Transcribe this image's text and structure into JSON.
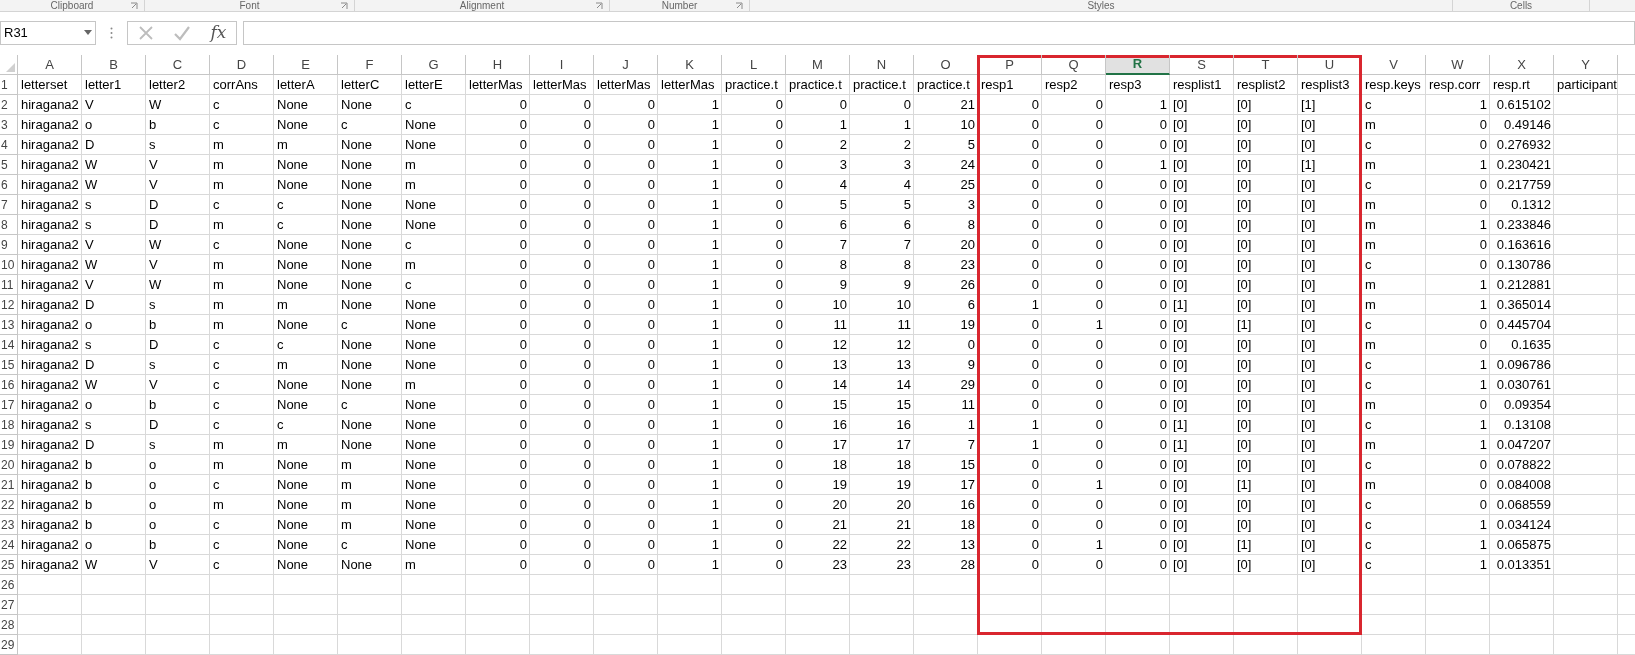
{
  "ribbon_groups": [
    {
      "label": "Clipboard",
      "launcher": true
    },
    {
      "label": "Font",
      "launcher": true
    },
    {
      "label": "Alignment",
      "launcher": true
    },
    {
      "label": "Number",
      "launcher": true
    },
    {
      "label": "Styles",
      "launcher": false
    },
    {
      "label": "Cells",
      "launcher": false
    }
  ],
  "formula_bar": {
    "name_box": "R31",
    "cancel_disabled": true,
    "enter_disabled": true,
    "function_label": "fx"
  },
  "columns": [
    {
      "letter": "A",
      "selected": false,
      "kind": "text",
      "boxed": false
    },
    {
      "letter": "B",
      "selected": false,
      "kind": "text",
      "boxed": false
    },
    {
      "letter": "C",
      "selected": false,
      "kind": "text",
      "boxed": false
    },
    {
      "letter": "D",
      "selected": false,
      "kind": "text",
      "boxed": false
    },
    {
      "letter": "E",
      "selected": false,
      "kind": "text",
      "boxed": false
    },
    {
      "letter": "F",
      "selected": false,
      "kind": "text",
      "boxed": false
    },
    {
      "letter": "G",
      "selected": false,
      "kind": "text",
      "boxed": false
    },
    {
      "letter": "H",
      "selected": false,
      "kind": "number",
      "boxed": false
    },
    {
      "letter": "I",
      "selected": false,
      "kind": "number",
      "boxed": false
    },
    {
      "letter": "J",
      "selected": false,
      "kind": "number",
      "boxed": false
    },
    {
      "letter": "K",
      "selected": false,
      "kind": "number",
      "boxed": false
    },
    {
      "letter": "L",
      "selected": false,
      "kind": "number",
      "boxed": false
    },
    {
      "letter": "M",
      "selected": false,
      "kind": "number",
      "boxed": false
    },
    {
      "letter": "N",
      "selected": false,
      "kind": "number",
      "boxed": false
    },
    {
      "letter": "O",
      "selected": false,
      "kind": "number",
      "boxed": false
    },
    {
      "letter": "P",
      "selected": false,
      "kind": "number",
      "boxed": true
    },
    {
      "letter": "Q",
      "selected": false,
      "kind": "number",
      "boxed": true
    },
    {
      "letter": "R",
      "selected": true,
      "kind": "number",
      "boxed": true
    },
    {
      "letter": "S",
      "selected": false,
      "kind": "text",
      "boxed": true
    },
    {
      "letter": "T",
      "selected": false,
      "kind": "text",
      "boxed": true
    },
    {
      "letter": "U",
      "selected": false,
      "kind": "text",
      "boxed": true
    },
    {
      "letter": "V",
      "selected": false,
      "kind": "text",
      "boxed": false
    },
    {
      "letter": "W",
      "selected": false,
      "kind": "number",
      "boxed": false
    },
    {
      "letter": "X",
      "selected": false,
      "kind": "number",
      "boxed": false
    },
    {
      "letter": "Y",
      "selected": false,
      "kind": "text",
      "boxed": false
    }
  ],
  "rows": [
    {
      "number": "1",
      "kind": "header",
      "cells": [
        "letterset",
        "letter1",
        "letter2",
        "corrAns",
        "letterA",
        "letterC",
        "letterE",
        "letterMas",
        "letterMas",
        "letterMas",
        "letterMas",
        "practice.t",
        "practice.t",
        "practice.t",
        "practice.t",
        "resp1",
        "resp2",
        "resp3",
        "resplist1",
        "resplist2",
        "resplist3",
        "resp.keys",
        "resp.corr",
        "resp.rt",
        "participant"
      ]
    },
    {
      "number": "2",
      "kind": "data",
      "cells": [
        "hiragana2",
        "V",
        "W",
        "c",
        "None",
        "None",
        "c",
        "0",
        "0",
        "0",
        "1",
        "0",
        "0",
        "0",
        "21",
        "0",
        "0",
        "1",
        "[0]",
        "[0]",
        "[1]",
        "c",
        "1",
        "0.615102"
      ]
    },
    {
      "number": "3",
      "kind": "data",
      "cells": [
        "hiragana2",
        "o",
        "b",
        "c",
        "None",
        "c",
        "None",
        "0",
        "0",
        "0",
        "1",
        "0",
        "1",
        "1",
        "10",
        "0",
        "0",
        "0",
        "[0]",
        "[0]",
        "[0]",
        "m",
        "0",
        "0.49146"
      ]
    },
    {
      "number": "4",
      "kind": "data",
      "cells": [
        "hiragana2",
        "D",
        "s",
        "m",
        "m",
        "None",
        "None",
        "0",
        "0",
        "0",
        "1",
        "0",
        "2",
        "2",
        "5",
        "0",
        "0",
        "0",
        "[0]",
        "[0]",
        "[0]",
        "c",
        "0",
        "0.276932"
      ]
    },
    {
      "number": "5",
      "kind": "data",
      "cells": [
        "hiragana2",
        "W",
        "V",
        "m",
        "None",
        "None",
        "m",
        "0",
        "0",
        "0",
        "1",
        "0",
        "3",
        "3",
        "24",
        "0",
        "0",
        "1",
        "[0]",
        "[0]",
        "[1]",
        "m",
        "1",
        "0.230421"
      ]
    },
    {
      "number": "6",
      "kind": "data",
      "cells": [
        "hiragana2",
        "W",
        "V",
        "m",
        "None",
        "None",
        "m",
        "0",
        "0",
        "0",
        "1",
        "0",
        "4",
        "4",
        "25",
        "0",
        "0",
        "0",
        "[0]",
        "[0]",
        "[0]",
        "c",
        "0",
        "0.217759"
      ]
    },
    {
      "number": "7",
      "kind": "data",
      "cells": [
        "hiragana2",
        "s",
        "D",
        "c",
        "c",
        "None",
        "None",
        "0",
        "0",
        "0",
        "1",
        "0",
        "5",
        "5",
        "3",
        "0",
        "0",
        "0",
        "[0]",
        "[0]",
        "[0]",
        "m",
        "0",
        "0.1312"
      ]
    },
    {
      "number": "8",
      "kind": "data",
      "cells": [
        "hiragana2",
        "s",
        "D",
        "m",
        "c",
        "None",
        "None",
        "0",
        "0",
        "0",
        "1",
        "0",
        "6",
        "6",
        "8",
        "0",
        "0",
        "0",
        "[0]",
        "[0]",
        "[0]",
        "m",
        "1",
        "0.233846"
      ]
    },
    {
      "number": "9",
      "kind": "data",
      "cells": [
        "hiragana2",
        "V",
        "W",
        "c",
        "None",
        "None",
        "c",
        "0",
        "0",
        "0",
        "1",
        "0",
        "7",
        "7",
        "20",
        "0",
        "0",
        "0",
        "[0]",
        "[0]",
        "[0]",
        "m",
        "0",
        "0.163616"
      ]
    },
    {
      "number": "10",
      "kind": "data",
      "cells": [
        "hiragana2",
        "W",
        "V",
        "m",
        "None",
        "None",
        "m",
        "0",
        "0",
        "0",
        "1",
        "0",
        "8",
        "8",
        "23",
        "0",
        "0",
        "0",
        "[0]",
        "[0]",
        "[0]",
        "c",
        "0",
        "0.130786"
      ]
    },
    {
      "number": "11",
      "kind": "data",
      "cells": [
        "hiragana2",
        "V",
        "W",
        "m",
        "None",
        "None",
        "c",
        "0",
        "0",
        "0",
        "1",
        "0",
        "9",
        "9",
        "26",
        "0",
        "0",
        "0",
        "[0]",
        "[0]",
        "[0]",
        "m",
        "1",
        "0.212881"
      ]
    },
    {
      "number": "12",
      "kind": "data",
      "cells": [
        "hiragana2",
        "D",
        "s",
        "m",
        "m",
        "None",
        "None",
        "0",
        "0",
        "0",
        "1",
        "0",
        "10",
        "10",
        "6",
        "1",
        "0",
        "0",
        "[1]",
        "[0]",
        "[0]",
        "m",
        "1",
        "0.365014"
      ]
    },
    {
      "number": "13",
      "kind": "data",
      "cells": [
        "hiragana2",
        "o",
        "b",
        "m",
        "None",
        "c",
        "None",
        "0",
        "0",
        "0",
        "1",
        "0",
        "11",
        "11",
        "19",
        "0",
        "1",
        "0",
        "[0]",
        "[1]",
        "[0]",
        "c",
        "0",
        "0.445704"
      ]
    },
    {
      "number": "14",
      "kind": "data",
      "cells": [
        "hiragana2",
        "s",
        "D",
        "c",
        "c",
        "None",
        "None",
        "0",
        "0",
        "0",
        "1",
        "0",
        "12",
        "12",
        "0",
        "0",
        "0",
        "0",
        "[0]",
        "[0]",
        "[0]",
        "m",
        "0",
        "0.1635"
      ]
    },
    {
      "number": "15",
      "kind": "data",
      "cells": [
        "hiragana2",
        "D",
        "s",
        "c",
        "m",
        "None",
        "None",
        "0",
        "0",
        "0",
        "1",
        "0",
        "13",
        "13",
        "9",
        "0",
        "0",
        "0",
        "[0]",
        "[0]",
        "[0]",
        "c",
        "1",
        "0.096786"
      ]
    },
    {
      "number": "16",
      "kind": "data",
      "cells": [
        "hiragana2",
        "W",
        "V",
        "c",
        "None",
        "None",
        "m",
        "0",
        "0",
        "0",
        "1",
        "0",
        "14",
        "14",
        "29",
        "0",
        "0",
        "0",
        "[0]",
        "[0]",
        "[0]",
        "c",
        "1",
        "0.030761"
      ]
    },
    {
      "number": "17",
      "kind": "data",
      "cells": [
        "hiragana2",
        "o",
        "b",
        "c",
        "None",
        "c",
        "None",
        "0",
        "0",
        "0",
        "1",
        "0",
        "15",
        "15",
        "11",
        "0",
        "0",
        "0",
        "[0]",
        "[0]",
        "[0]",
        "m",
        "0",
        "0.09354"
      ]
    },
    {
      "number": "18",
      "kind": "data",
      "cells": [
        "hiragana2",
        "s",
        "D",
        "c",
        "c",
        "None",
        "None",
        "0",
        "0",
        "0",
        "1",
        "0",
        "16",
        "16",
        "1",
        "1",
        "0",
        "0",
        "[1]",
        "[0]",
        "[0]",
        "c",
        "1",
        "0.13108"
      ]
    },
    {
      "number": "19",
      "kind": "data",
      "cells": [
        "hiragana2",
        "D",
        "s",
        "m",
        "m",
        "None",
        "None",
        "0",
        "0",
        "0",
        "1",
        "0",
        "17",
        "17",
        "7",
        "1",
        "0",
        "0",
        "[1]",
        "[0]",
        "[0]",
        "m",
        "1",
        "0.047207"
      ]
    },
    {
      "number": "20",
      "kind": "data",
      "cells": [
        "hiragana2",
        "b",
        "o",
        "m",
        "None",
        "m",
        "None",
        "0",
        "0",
        "0",
        "1",
        "0",
        "18",
        "18",
        "15",
        "0",
        "0",
        "0",
        "[0]",
        "[0]",
        "[0]",
        "c",
        "0",
        "0.078822"
      ]
    },
    {
      "number": "21",
      "kind": "data",
      "cells": [
        "hiragana2",
        "b",
        "o",
        "c",
        "None",
        "m",
        "None",
        "0",
        "0",
        "0",
        "1",
        "0",
        "19",
        "19",
        "17",
        "0",
        "1",
        "0",
        "[0]",
        "[1]",
        "[0]",
        "m",
        "0",
        "0.084008"
      ]
    },
    {
      "number": "22",
      "kind": "data",
      "cells": [
        "hiragana2",
        "b",
        "o",
        "m",
        "None",
        "m",
        "None",
        "0",
        "0",
        "0",
        "1",
        "0",
        "20",
        "20",
        "16",
        "0",
        "0",
        "0",
        "[0]",
        "[0]",
        "[0]",
        "c",
        "0",
        "0.068559"
      ]
    },
    {
      "number": "23",
      "kind": "data",
      "cells": [
        "hiragana2",
        "b",
        "o",
        "c",
        "None",
        "m",
        "None",
        "0",
        "0",
        "0",
        "1",
        "0",
        "21",
        "21",
        "18",
        "0",
        "0",
        "0",
        "[0]",
        "[0]",
        "[0]",
        "c",
        "1",
        "0.034124"
      ]
    },
    {
      "number": "24",
      "kind": "data",
      "cells": [
        "hiragana2",
        "o",
        "b",
        "c",
        "None",
        "c",
        "None",
        "0",
        "0",
        "0",
        "1",
        "0",
        "22",
        "22",
        "13",
        "0",
        "1",
        "0",
        "[0]",
        "[1]",
        "[0]",
        "c",
        "1",
        "0.065875"
      ]
    },
    {
      "number": "25",
      "kind": "data",
      "cells": [
        "hiragana2",
        "W",
        "V",
        "c",
        "None",
        "None",
        "m",
        "0",
        "0",
        "0",
        "1",
        "0",
        "23",
        "23",
        "28",
        "0",
        "0",
        "0",
        "[0]",
        "[0]",
        "[0]",
        "c",
        "1",
        "0.013351"
      ]
    },
    {
      "number": "26",
      "kind": "empty",
      "cells": []
    },
    {
      "number": "27",
      "kind": "empty",
      "cells": []
    },
    {
      "number": "28",
      "kind": "empty",
      "cells": []
    },
    {
      "number": "29",
      "kind": "empty",
      "cells": []
    }
  ]
}
